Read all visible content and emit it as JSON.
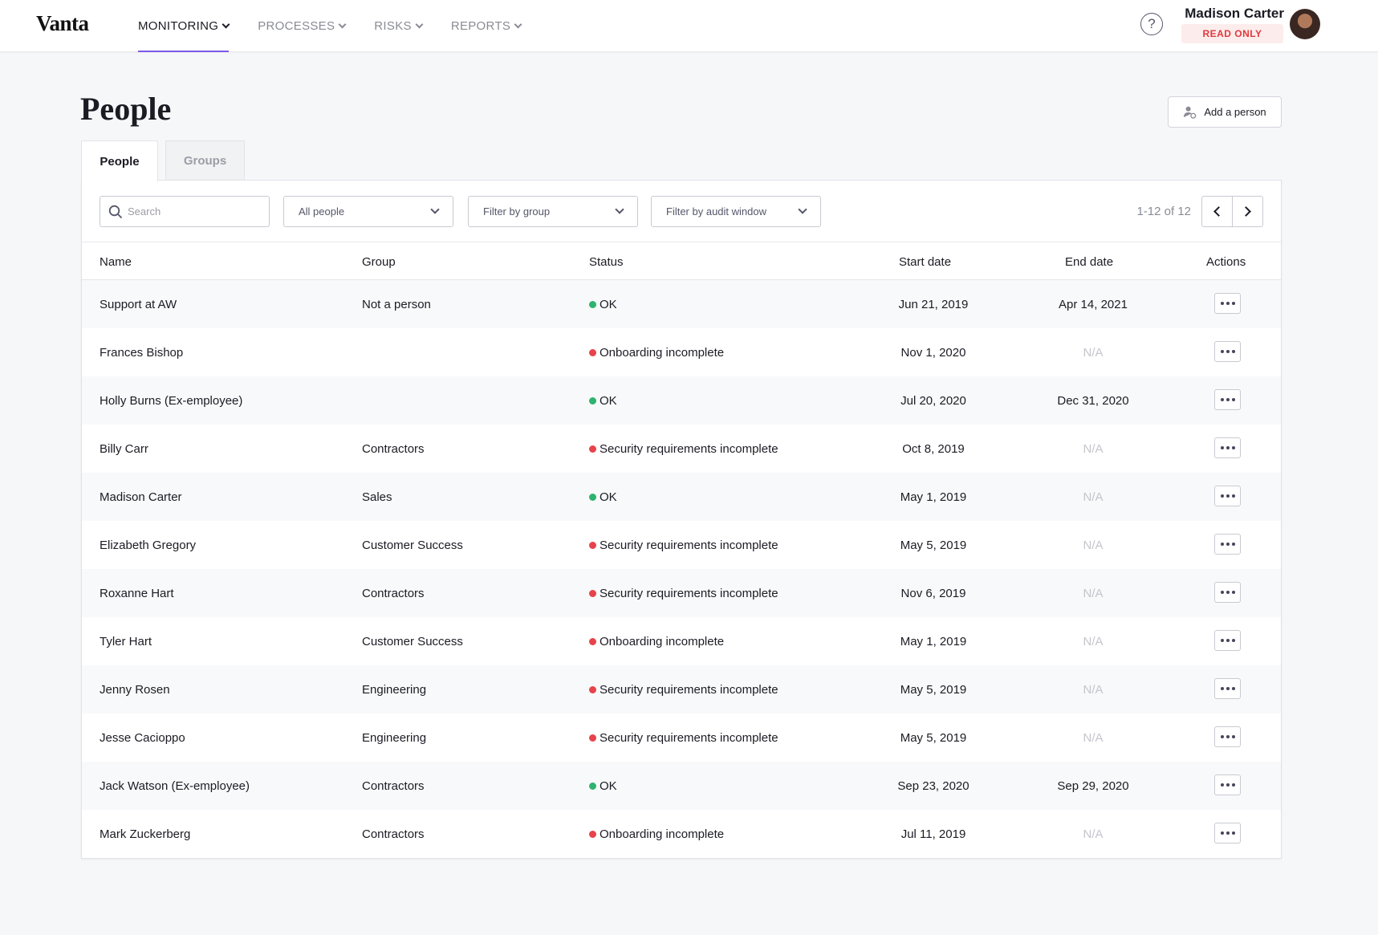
{
  "header": {
    "logo": "Vanta",
    "nav": [
      {
        "label": "MONITORING",
        "active": true
      },
      {
        "label": "PROCESSES",
        "active": false
      },
      {
        "label": "RISKS",
        "active": false
      },
      {
        "label": "REPORTS",
        "active": false
      }
    ],
    "help_icon": "question-circle-icon",
    "user": {
      "name": "Madison Carter",
      "badge": "READ ONLY"
    }
  },
  "page": {
    "title": "People",
    "add_button": "Add a person",
    "tabs": [
      {
        "label": "People",
        "active": true
      },
      {
        "label": "Groups",
        "active": false
      }
    ]
  },
  "filters": {
    "search_placeholder": "Search",
    "people_select": "All people",
    "group_select": "Filter by group",
    "audit_select": "Filter by audit window",
    "pagination": "1-12 of 12"
  },
  "table": {
    "columns": [
      "Name",
      "Group",
      "Status",
      "Start date",
      "End date",
      "Actions"
    ],
    "rows": [
      {
        "name": "Support at AW",
        "group": "Not a person",
        "status": "OK",
        "status_ok": true,
        "start": "Jun 21, 2019",
        "end": "Apr 14, 2021"
      },
      {
        "name": "Frances Bishop",
        "group": "",
        "status": "Onboarding incomplete",
        "status_ok": false,
        "start": "Nov 1, 2020",
        "end": "N/A"
      },
      {
        "name": "Holly Burns (Ex-employee)",
        "group": "",
        "status": "OK",
        "status_ok": true,
        "start": "Jul 20, 2020",
        "end": "Dec 31, 2020"
      },
      {
        "name": "Billy Carr",
        "group": "Contractors",
        "status": "Security requirements incomplete",
        "status_ok": false,
        "start": "Oct 8, 2019",
        "end": "N/A"
      },
      {
        "name": "Madison Carter",
        "group": "Sales",
        "status": "OK",
        "status_ok": true,
        "start": "May 1, 2019",
        "end": "N/A"
      },
      {
        "name": "Elizabeth Gregory",
        "group": "Customer Success",
        "status": "Security requirements incomplete",
        "status_ok": false,
        "start": "May 5, 2019",
        "end": "N/A"
      },
      {
        "name": "Roxanne Hart",
        "group": "Contractors",
        "status": "Security requirements incomplete",
        "status_ok": false,
        "start": "Nov 6, 2019",
        "end": "N/A"
      },
      {
        "name": "Tyler Hart",
        "group": "Customer Success",
        "status": "Onboarding incomplete",
        "status_ok": false,
        "start": "May 1, 2019",
        "end": "N/A"
      },
      {
        "name": "Jenny Rosen",
        "group": "Engineering",
        "status": "Security requirements incomplete",
        "status_ok": false,
        "start": "May 5, 2019",
        "end": "N/A"
      },
      {
        "name": "Jesse Cacioppo",
        "group": "Engineering",
        "status": "Security requirements incomplete",
        "status_ok": false,
        "start": "May 5, 2019",
        "end": "N/A"
      },
      {
        "name": "Jack Watson (Ex-employee)",
        "group": "Contractors",
        "status": "OK",
        "status_ok": true,
        "start": "Sep 23, 2020",
        "end": "Sep 29, 2020"
      },
      {
        "name": "Mark Zuckerberg",
        "group": "Contractors",
        "status": "Onboarding incomplete",
        "status_ok": false,
        "start": "Jul 11, 2019",
        "end": "N/A"
      }
    ]
  },
  "colors": {
    "accent": "#7a5ae6",
    "ok": "#2fb36f",
    "error": "#e6434b",
    "read_only_text": "#e0393e"
  }
}
